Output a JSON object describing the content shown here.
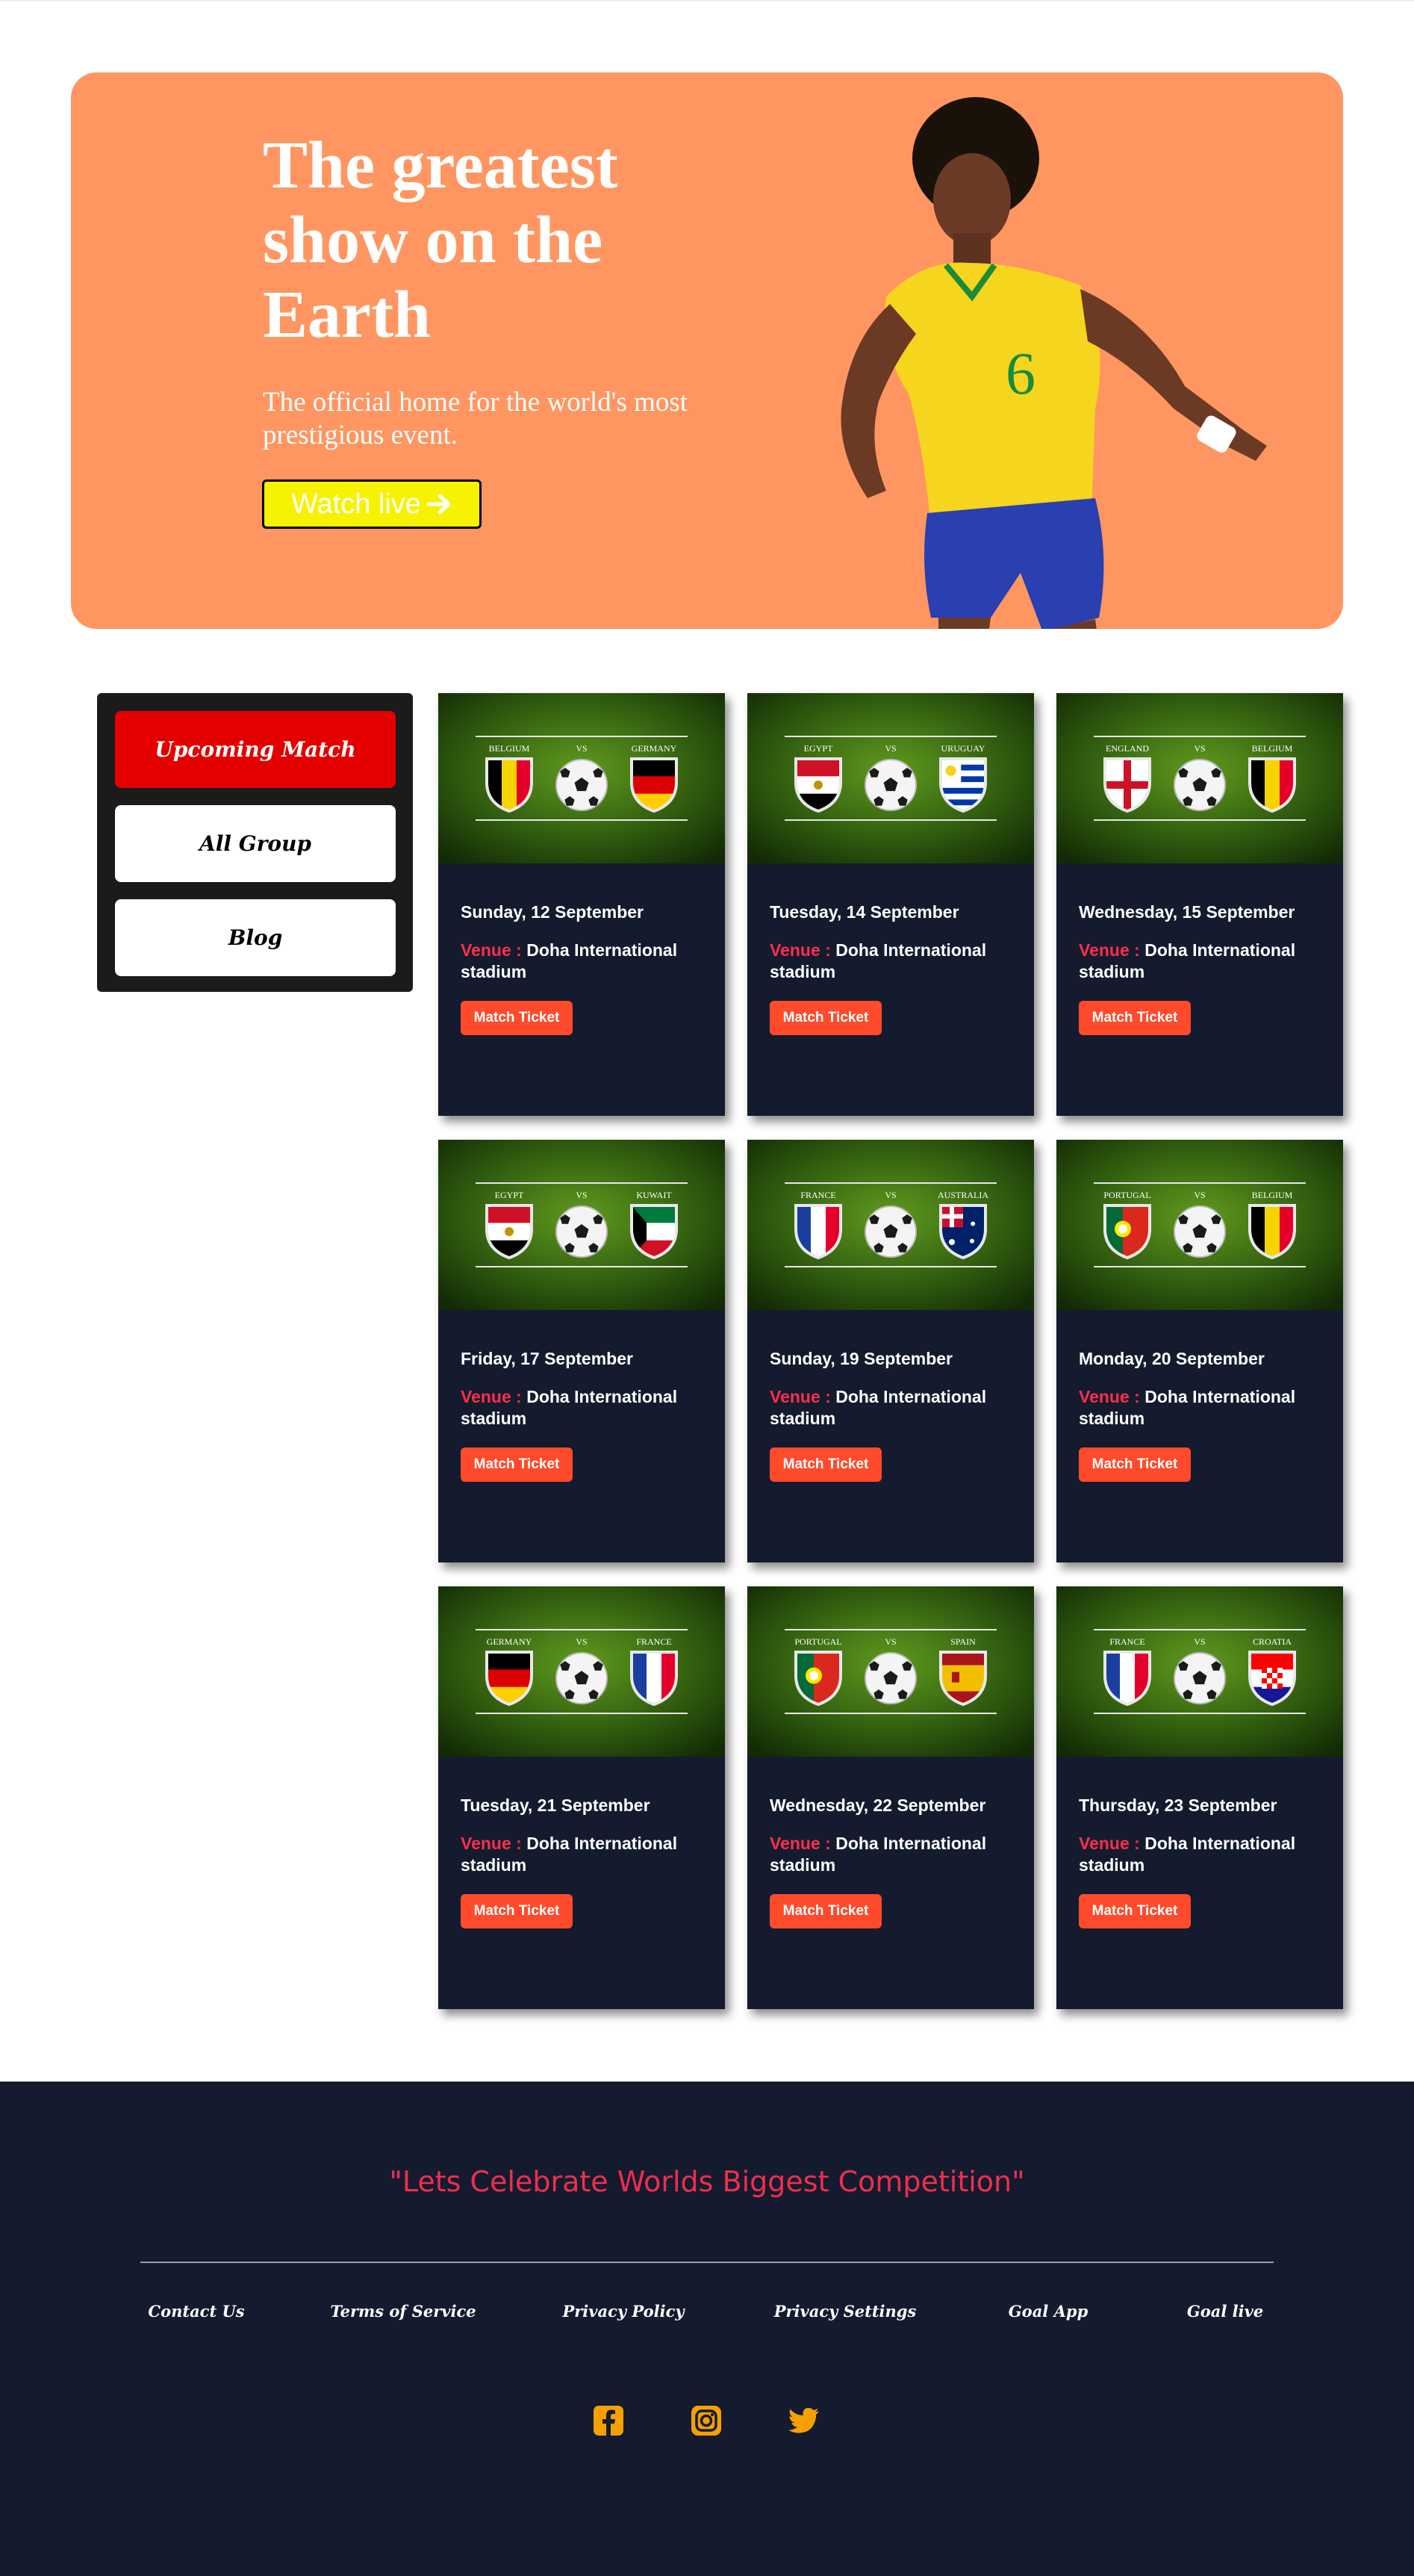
{
  "hero": {
    "title": "The greatest show on the Earth",
    "subtitle": "The official home for the world's most prestigious event.",
    "watch_label": "Watch live",
    "watch_icon": "arrow-right-icon",
    "background_color": "#ff9661",
    "button_color": "#f7f200"
  },
  "sidebar": {
    "items": [
      {
        "label": "Upcoming Match",
        "active": true
      },
      {
        "label": "All Group",
        "active": false
      },
      {
        "label": "Blog",
        "active": false
      }
    ]
  },
  "matches": {
    "venue_label": "Venue :",
    "venue": "Doha International stadium",
    "ticket_label": "Match Ticket",
    "vs_label": "VS",
    "items": [
      {
        "date": "Sunday, 12 September",
        "team1": "BELGIUM",
        "team2": "GERMANY"
      },
      {
        "date": "Tuesday, 14 September",
        "team1": "EGYPT",
        "team2": "URUGUAY"
      },
      {
        "date": "Wednesday, 15 September",
        "team1": "ENGLAND",
        "team2": "BELGIUM"
      },
      {
        "date": "Friday, 17 September",
        "team1": "EGYPT",
        "team2": "KUWAIT"
      },
      {
        "date": "Sunday, 19 September",
        "team1": "FRANCE",
        "team2": "AUSTRALIA"
      },
      {
        "date": "Monday, 20 September",
        "team1": "PORTUGAL",
        "team2": "BELGIUM"
      },
      {
        "date": "Tuesday, 21 September",
        "team1": "GERMANY",
        "team2": "FRANCE"
      },
      {
        "date": "Wednesday, 22 September",
        "team1": "PORTUGAL",
        "team2": "SPAIN"
      },
      {
        "date": "Thursday, 23 September",
        "team1": "FRANCE",
        "team2": "CROATIA"
      }
    ]
  },
  "footer": {
    "tagline": "\"Lets Celebrate Worlds Biggest Competition\"",
    "links": [
      {
        "label": "Contact Us"
      },
      {
        "label": "Terms of Service"
      },
      {
        "label": "Privacy Policy"
      },
      {
        "label": "Privacy Settings"
      },
      {
        "label": "Goal App"
      },
      {
        "label": "Goal live"
      }
    ],
    "social": [
      {
        "icon": "facebook-icon"
      },
      {
        "icon": "instagram-icon"
      },
      {
        "icon": "twitter-icon"
      }
    ],
    "accent_color": "#f5a000",
    "background_color": "#141b2e"
  }
}
